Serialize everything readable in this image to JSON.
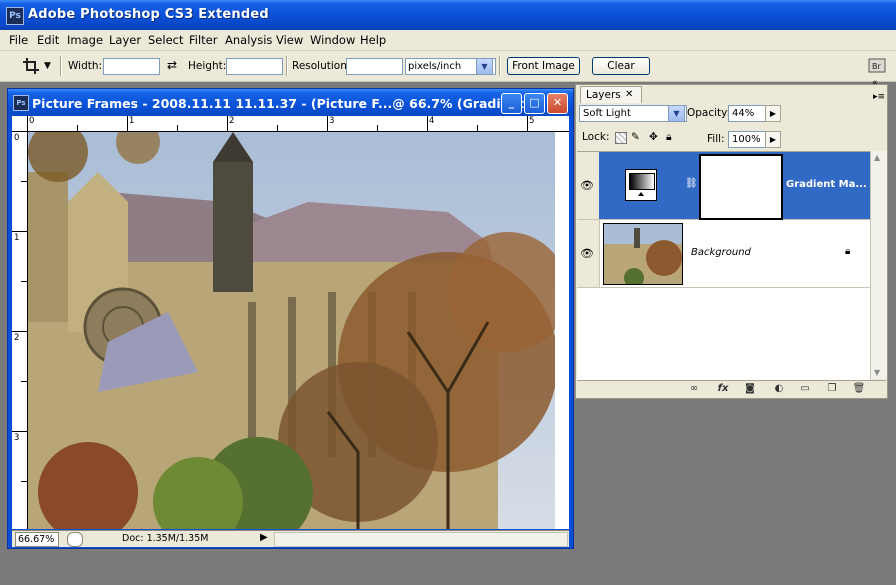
{
  "app": {
    "title": "Adobe Photoshop CS3 Extended",
    "logo": "Ps"
  },
  "menubar": [
    "File",
    "Edit",
    "Image",
    "Layer",
    "Select",
    "Filter",
    "Analysis",
    "View",
    "Window",
    "Help"
  ],
  "options": {
    "width_label": "Width:",
    "height_label": "Height:",
    "resolution_label": "Resolution:",
    "units": "pixels/inch",
    "front_image_button": "Front Image",
    "clear_button": "Clear"
  },
  "document": {
    "title": "Picture Frames - 2008.11.11 11.11.37 - (Picture F...@ 66.7% (Gradient...",
    "ruler_top": [
      "0",
      "1",
      "2",
      "3",
      "4",
      "5"
    ],
    "ruler_left": [
      "0",
      "1",
      "2",
      "3"
    ],
    "zoom": "66.67%",
    "doc_info": "Doc: 1.35M/1.35M"
  },
  "layers_panel": {
    "tab": "Layers",
    "blend_mode": "Soft Light",
    "opacity_label": "Opacity:",
    "opacity_value": "44%",
    "lock_label": "Lock:",
    "fill_label": "Fill:",
    "fill_value": "100%",
    "layers": [
      {
        "name": "Gradient Ma...",
        "selected": true
      },
      {
        "name": "Background",
        "selected": false,
        "locked": true
      }
    ]
  },
  "colors": {
    "xp_blue": "#0a4fd6",
    "panel_bg": "#ece9d8",
    "selection": "#316ac5"
  }
}
